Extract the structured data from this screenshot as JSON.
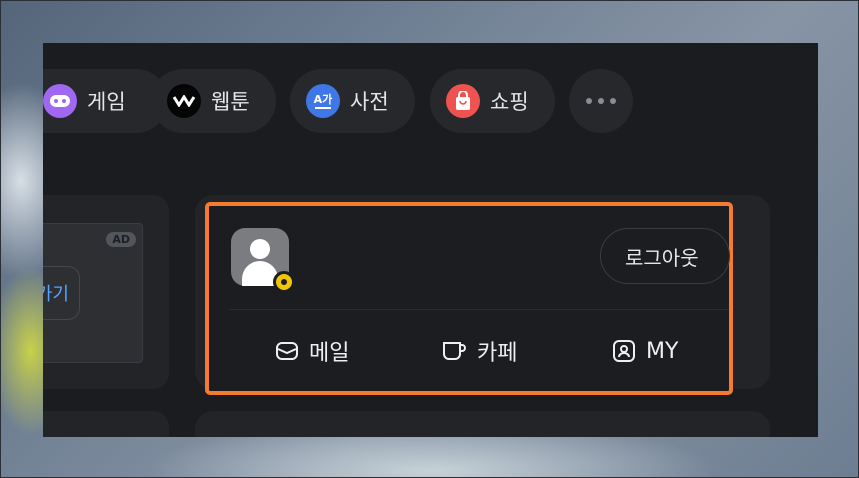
{
  "nav": {
    "items": [
      {
        "label": "게임",
        "icon": "game-controller-icon",
        "color": "#a067f0"
      },
      {
        "label": "웹툰",
        "icon": "webtoon-icon",
        "color": "#050505"
      },
      {
        "label": "사전",
        "icon": "dictionary-icon",
        "color": "#3f78e6",
        "icon_text": "A가"
      },
      {
        "label": "쇼핑",
        "icon": "shopping-bag-icon",
        "color": "#ee5350"
      }
    ],
    "more_icon": "more-dots-icon"
  },
  "ad": {
    "badge": "AD",
    "button_label": "가기"
  },
  "profile": {
    "logout_label": "로그아웃",
    "quick_links": [
      {
        "label": "메일",
        "icon": "mail-icon"
      },
      {
        "label": "카페",
        "icon": "cup-icon"
      },
      {
        "label": "MY",
        "icon": "person-badge-icon"
      }
    ]
  },
  "colors": {
    "highlight": "#f47b30",
    "background": "#1b1c1f",
    "card": "#232428"
  }
}
